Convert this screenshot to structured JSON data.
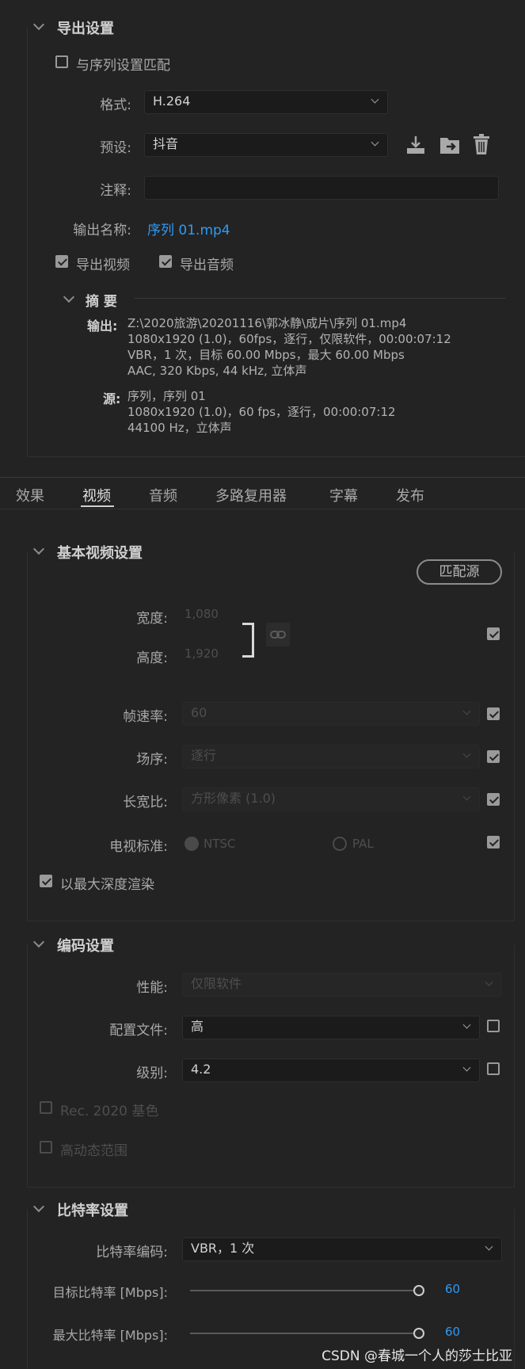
{
  "export": {
    "title": "导出设置",
    "match_sequence_label": "与序列设置匹配",
    "format_label": "格式:",
    "format_value": "H.264",
    "preset_label": "预设:",
    "preset_value": "抖音",
    "comment_label": "注释:",
    "comment_value": "",
    "output_name_label": "输出名称:",
    "output_name_value": "序列 01.mp4",
    "export_video_label": "导出视频",
    "export_audio_label": "导出音频"
  },
  "summary": {
    "title": "摘 要",
    "output_label": "输出:",
    "output_lines": [
      "Z:\\2020旅游\\20201116\\郭冰静\\成片\\序列 01.mp4",
      "1080x1920 (1.0)，60fps，逐行，仅限软件，00:00:07:12",
      "VBR，1 次，目标 60.00 Mbps，最大 60.00 Mbps",
      "AAC, 320 Kbps, 44  kHz, 立体声"
    ],
    "source_label": "源:",
    "source_lines": [
      "序列，序列 01",
      "1080x1920 (1.0)，60 fps，逐行，00:00:07:12",
      "44100 Hz，立体声"
    ]
  },
  "tabs": [
    "效果",
    "视频",
    "音频",
    "多路复用器",
    "字幕",
    "发布"
  ],
  "basic_video": {
    "title": "基本视频设置",
    "match_source_button": "匹配源",
    "width_label": "宽度:",
    "width_value": "1,080",
    "height_label": "高度:",
    "height_value": "1,920",
    "frame_rate_label": "帧速率:",
    "frame_rate_value": "60",
    "field_order_label": "场序:",
    "field_order_value": "逐行",
    "aspect_label": "长宽比:",
    "aspect_value": "方形像素 (1.0)",
    "tv_standard_label": "电视标准:",
    "ntsc": "NTSC",
    "pal": "PAL",
    "max_depth_label": "以最大深度渲染"
  },
  "encoding": {
    "title": "编码设置",
    "performance_label": "性能:",
    "performance_value": "仅限软件",
    "profile_label": "配置文件:",
    "profile_value": "高",
    "level_label": "级别:",
    "level_value": "4.2",
    "rec2020_label": "Rec. 2020 基色",
    "hdr_label": "高动态范围"
  },
  "bitrate": {
    "title": "比特率设置",
    "encoding_label": "比特率编码:",
    "encoding_value": "VBR，1 次",
    "target_label": "目标比特率 [Mbps]:",
    "target_value": "60",
    "max_label": "最大比特率 [Mbps]:",
    "max_value": "60"
  },
  "watermark": "CSDN @春城一个人的莎士比亚",
  "colors": {
    "accent": "#2e9bf5",
    "background": "#232323"
  }
}
